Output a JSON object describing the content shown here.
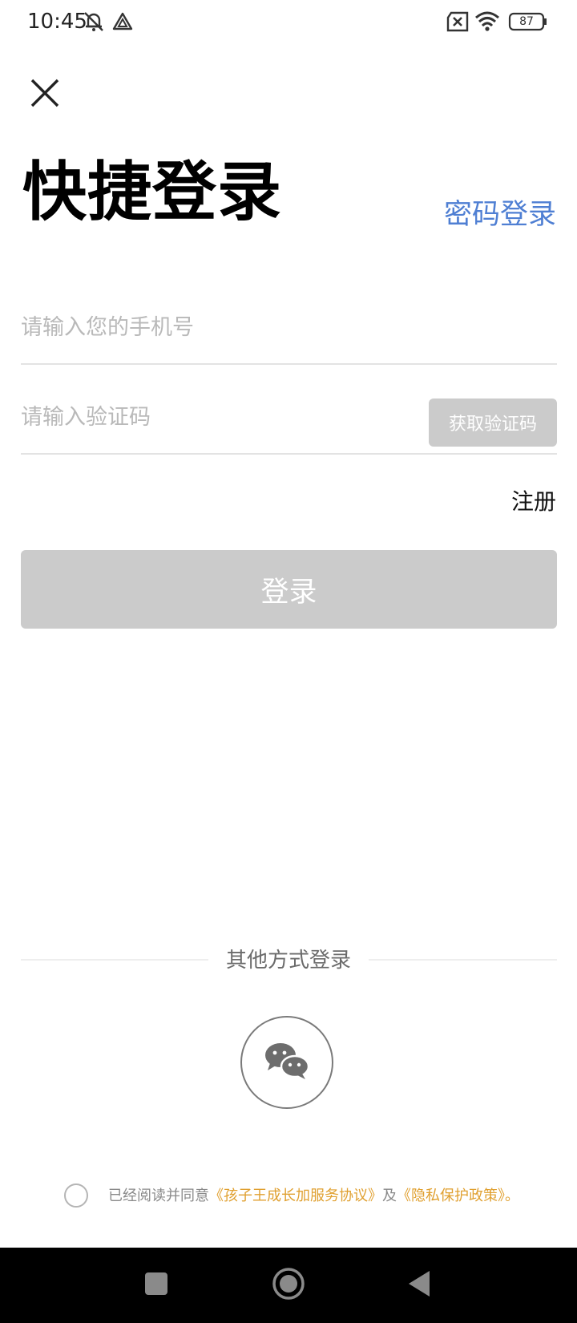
{
  "status_bar": {
    "time": "10:45",
    "battery": "87",
    "icons": [
      "bell-off-icon",
      "triangle-icon",
      "sim-x-icon",
      "wifi-icon",
      "battery-icon"
    ]
  },
  "header": {
    "close_icon": "close-icon",
    "title": "快捷登录",
    "password_login": "密码登录"
  },
  "form": {
    "phone_placeholder": "请输入您的手机号",
    "code_placeholder": "请输入验证码",
    "get_code_label": "获取验证码",
    "register_label": "注册",
    "login_label": "登录"
  },
  "other_login": {
    "label": "其他方式登录",
    "wechat_icon": "wechat-icon"
  },
  "agreement": {
    "prefix": "已经阅读并同意",
    "service_link": "《孩子王成长加服务协议》",
    "and": "及",
    "privacy_link": "《隐私保护政策》",
    "suffix": "。"
  },
  "colors": {
    "accent_blue": "#4f7fd3",
    "link_orange": "#e0a030",
    "disabled_gray": "#cbcbcb"
  },
  "nav_bar": {
    "icons": [
      "recents-icon",
      "home-icon",
      "back-icon"
    ]
  }
}
